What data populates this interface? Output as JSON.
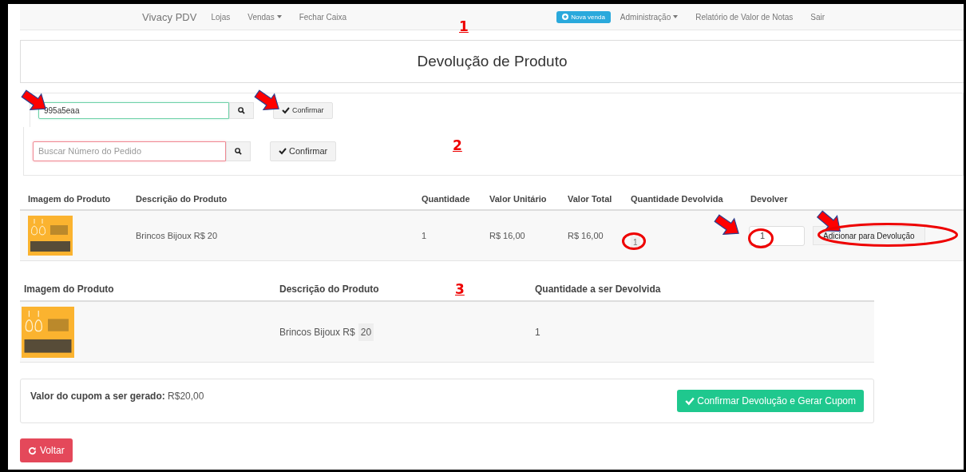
{
  "navbar": {
    "brand": "Vivacy PDV",
    "left_items": [
      {
        "label": "Lojas",
        "kind": "link"
      },
      {
        "label": "Vendas",
        "kind": "dropdown"
      },
      {
        "label": "Fechar Caixa",
        "kind": "link"
      }
    ],
    "right_items": [
      {
        "label": "Nova venda",
        "kind": "primary"
      },
      {
        "label": "Administração",
        "kind": "dropdown"
      },
      {
        "label": "Relatório de Valor de Notas",
        "kind": "link"
      },
      {
        "label": "Sair",
        "kind": "link"
      }
    ]
  },
  "title": "Devolução de Produto",
  "search_rows": [
    {
      "value": "995a5eaa",
      "valid": true,
      "button": "Confirmar"
    },
    {
      "placeholder": "Buscar Número do Pedido",
      "valid": false,
      "button": "Confirmar"
    }
  ],
  "products_table": {
    "columns": [
      "Imagem do Produto",
      "Descrição do Produto",
      "Quantidade",
      "Valor Unitário",
      "Valor Total",
      "Quantidade Devolvida",
      "Devolver"
    ],
    "rows": [
      {
        "description": "Brincos Bijoux R$ 20",
        "quantity": "1",
        "unit_value": "R$ 16,00",
        "total_value": "R$ 16,00",
        "returned_quantity": "1",
        "return_input": "1",
        "button": "Adicionar para Devolução"
      }
    ]
  },
  "return_table": {
    "columns": [
      "Imagem do Produto",
      "Descrição do Produto",
      "Quantidade a ser Devolvida"
    ],
    "rows": [
      {
        "description": "Brincos Bijoux R$",
        "description_value": "20",
        "quantity": "1"
      }
    ]
  },
  "coupon": {
    "label": "Valor do cupom a ser gerado:",
    "currency": "R$",
    "value": "20",
    "cents": ",00",
    "button": "Confirmar Devolução e Gerar Cupom"
  },
  "back_button": "Voltar",
  "annotations": {
    "markers": [
      "1",
      "2",
      "3"
    ]
  }
}
